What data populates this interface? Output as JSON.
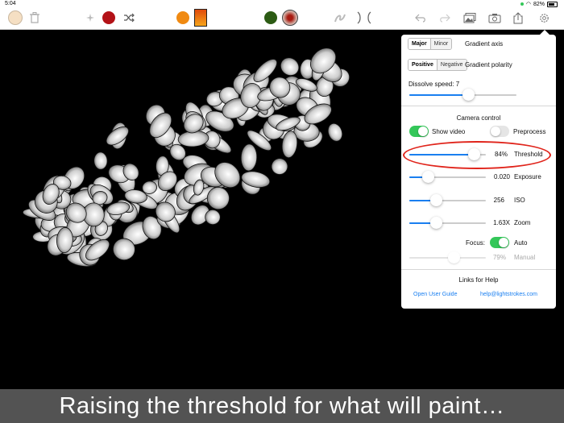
{
  "status": {
    "time": "5:04",
    "battery": "82%"
  },
  "toolbar": {
    "colors": {
      "cream": "#f5dfc3",
      "red": "#b31217",
      "orange": "#f08a12",
      "green": "#2c5b14"
    },
    "icons": [
      "trash-icon",
      "sparkle-icon",
      "shuffle-icon",
      "stroke-icon",
      "symmetry-icon",
      "undo-icon",
      "redo-icon",
      "gallery-icon",
      "camera-icon",
      "share-icon",
      "gear-icon"
    ]
  },
  "popover": {
    "axis": {
      "options": [
        "Major",
        "Minor"
      ],
      "selected": "Major",
      "label": "Gradient axis"
    },
    "polarity": {
      "options": [
        "Positive",
        "Negative"
      ],
      "selected": "Positive",
      "label": "Gradient polarity"
    },
    "dissolve": {
      "label": "Dissolve speed: 7",
      "value": 7,
      "max": 14
    },
    "camera": {
      "title": "Camera control",
      "show_video": {
        "label": "Show video",
        "on": true
      },
      "preprocess": {
        "label": "Preprocess",
        "on": false
      },
      "threshold": {
        "value": "84%",
        "label": "Threshold",
        "fraction": 0.84
      },
      "exposure": {
        "value": "0.020",
        "label": "Exposure",
        "fraction": 0.15
      },
      "iso": {
        "value": "256",
        "label": "ISO",
        "fraction": 0.3
      },
      "zoom": {
        "value": "1.63X",
        "label": "Zoom",
        "fraction": 0.3
      },
      "focus": {
        "label": "Focus:",
        "auto_label": "Auto",
        "on": true
      },
      "manual": {
        "value": "79%",
        "label": "Manual",
        "fraction": 0.5
      }
    },
    "help": {
      "title": "Links for Help",
      "guide": "Open User Guide",
      "email": "help@lightstrokes.com"
    }
  },
  "caption": "Raising the threshold for what will paint…"
}
